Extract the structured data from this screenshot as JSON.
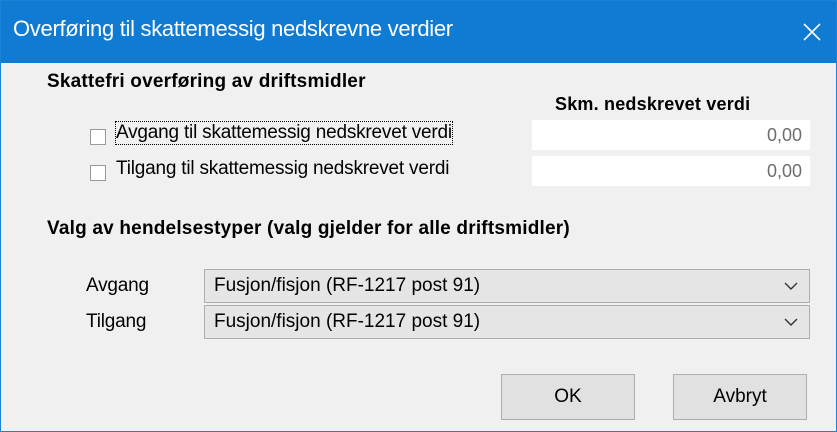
{
  "window": {
    "title": "Overføring til skattemessig nedskrevne verdier",
    "close_glyph": "✕"
  },
  "section1": {
    "heading": "Skattefri overføring av driftsmidler",
    "column_header": "Skm. nedskrevet verdi",
    "rows": [
      {
        "label": "Avgang til skattemessig nedskrevet verdi",
        "checked": false,
        "value": "0,00"
      },
      {
        "label": "Tilgang til skattemessig nedskrevet verdi",
        "checked": false,
        "value": "0,00"
      }
    ]
  },
  "section2": {
    "heading": "Valg av hendelsestyper (valg gjelder for alle driftsmidler)",
    "avgang_label": "Avgang",
    "avgang_value": "Fusjon/fisjon (RF-1217 post 91)",
    "tilgang_label": "Tilgang",
    "tilgang_value": "Fusjon/fisjon (RF-1217 post 91)"
  },
  "buttons": {
    "ok": "OK",
    "cancel": "Avbryt"
  },
  "colors": {
    "titlebar": "#0f7bd3",
    "dialog_bg": "#f0f0f0",
    "value_text": "#6d6d6d"
  },
  "icons": [
    "close-icon",
    "chevron-down-icon"
  ]
}
